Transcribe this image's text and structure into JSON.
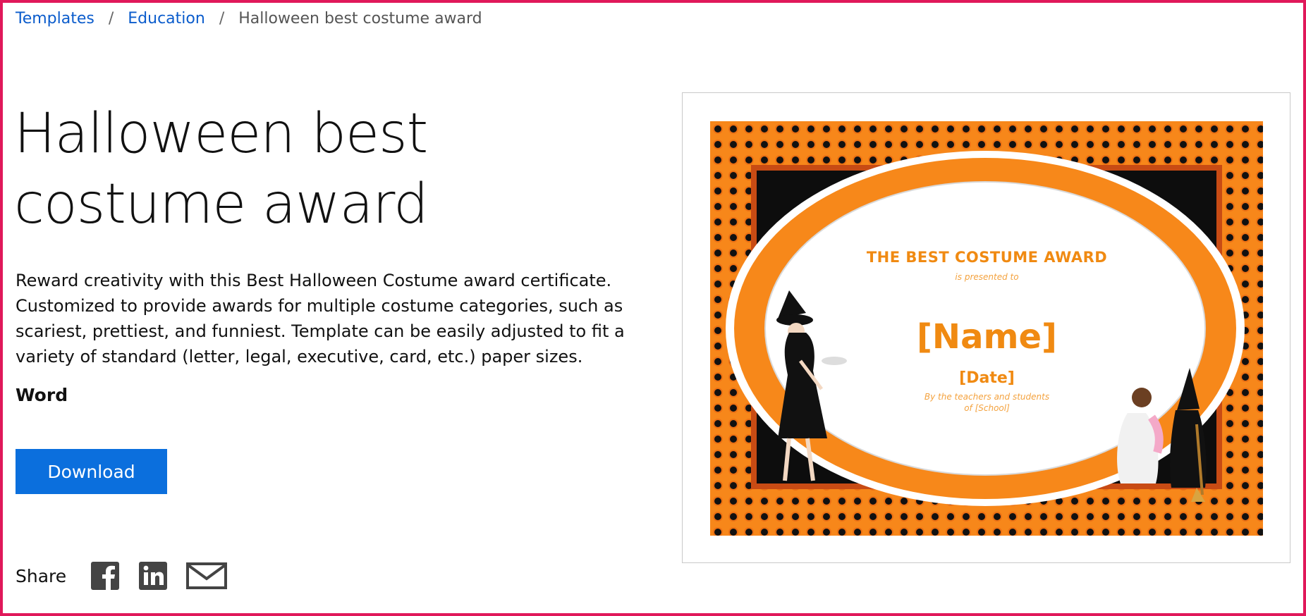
{
  "breadcrumb": {
    "items": [
      "Templates",
      "Education"
    ],
    "current": "Halloween best costume award",
    "separator": "/"
  },
  "page": {
    "title": "Halloween best costume award",
    "description_lines": [
      "Reward creativity with this Best Halloween Costume award certificate.",
      "Customized to provide awards for multiple costume categories, such as",
      "scariest, prettiest, and funniest. Template can be easily adjusted to fit a",
      "variety of standard (letter, legal, executive, card, etc.) paper sizes."
    ],
    "app": "Word"
  },
  "actions": {
    "download_label": "Download"
  },
  "share": {
    "label": "Share",
    "icons": [
      "facebook-icon",
      "linkedin-icon",
      "email-icon"
    ]
  },
  "preview": {
    "heading": "THE BEST COSTUME AWARD",
    "presented": "is presented to",
    "name": "[Name]",
    "date": "[Date]",
    "by_line": "By the teachers and students",
    "school_line": "of [School]"
  },
  "colors": {
    "link": "#0b5ccc",
    "button": "#0b6fdd",
    "cert_orange": "#f08a12",
    "frame": "#e0185a"
  }
}
